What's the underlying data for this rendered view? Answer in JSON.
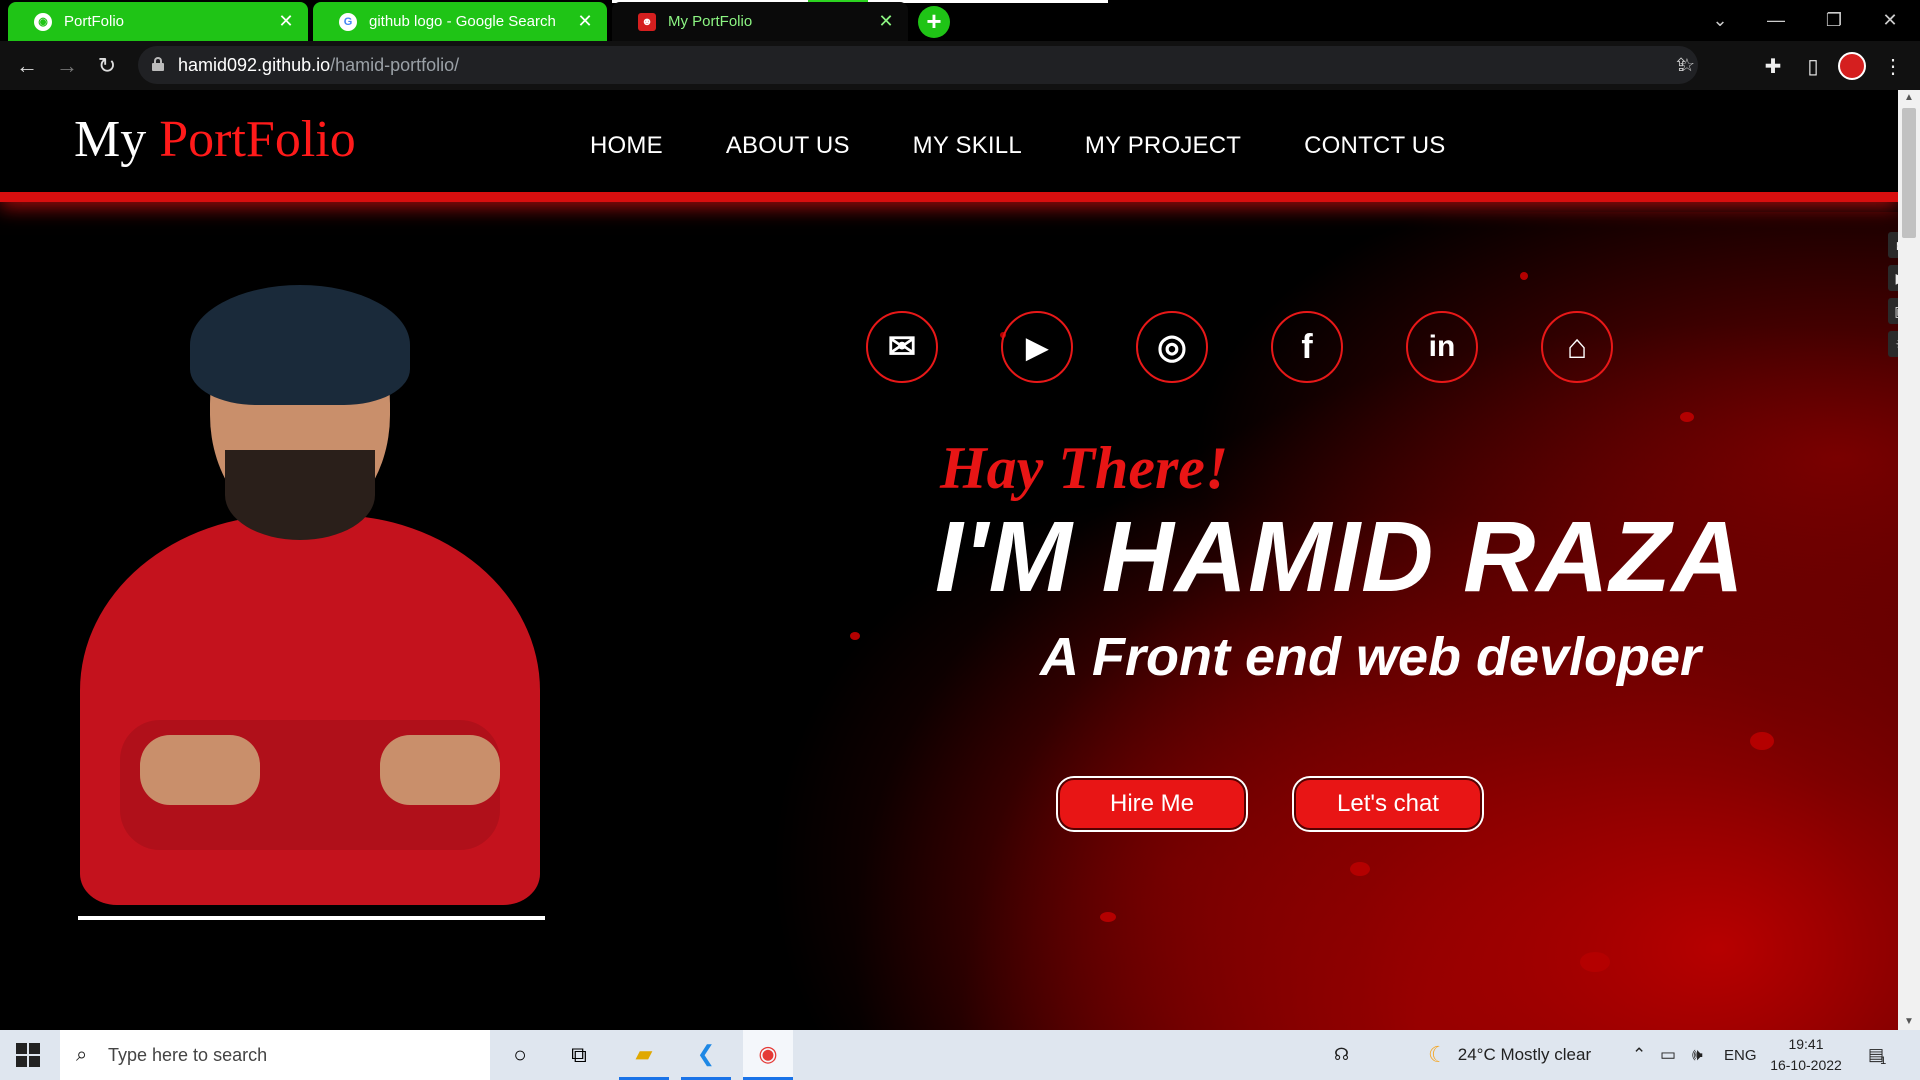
{
  "browser": {
    "tabs": [
      {
        "title": "PortFolio",
        "active": false
      },
      {
        "title": "github logo - Google Search",
        "active": false
      },
      {
        "title": "My PortFolio",
        "active": true
      }
    ],
    "url_host": "hamid092.github.io",
    "url_path": "/hamid-portfolio/",
    "new_tab": "+",
    "close_glyph": "✕"
  },
  "site": {
    "logo_main": "My ",
    "logo_accent": "PortFolio",
    "nav": [
      "HOME",
      "ABOUT US",
      "MY SKILL",
      "MY PROJECT",
      "CONTCT US"
    ],
    "greeting": "Hay There!",
    "name": "I'M HAMID RAZA",
    "role": "A Front end web devloper",
    "buttons": {
      "hire": "Hire Me",
      "chat": "Let's chat"
    },
    "socials": [
      {
        "icon": "mail-icon",
        "glyph": "✉"
      },
      {
        "icon": "youtube-icon",
        "glyph": "▶"
      },
      {
        "icon": "instagram-icon",
        "glyph": "◎"
      },
      {
        "icon": "facebook-icon",
        "glyph": "f"
      },
      {
        "icon": "linkedin-icon",
        "glyph": "in"
      },
      {
        "icon": "github-icon",
        "glyph": "⌂"
      }
    ],
    "colors": {
      "accent": "#e81515",
      "background": "#000000",
      "tab_green": "#1fc416"
    }
  },
  "taskbar": {
    "search_placeholder": "Type here to search",
    "weather": "24°C  Mostly clear",
    "lang": "ENG",
    "time": "19:41",
    "date": "16-10-2022",
    "notifications": "1"
  }
}
